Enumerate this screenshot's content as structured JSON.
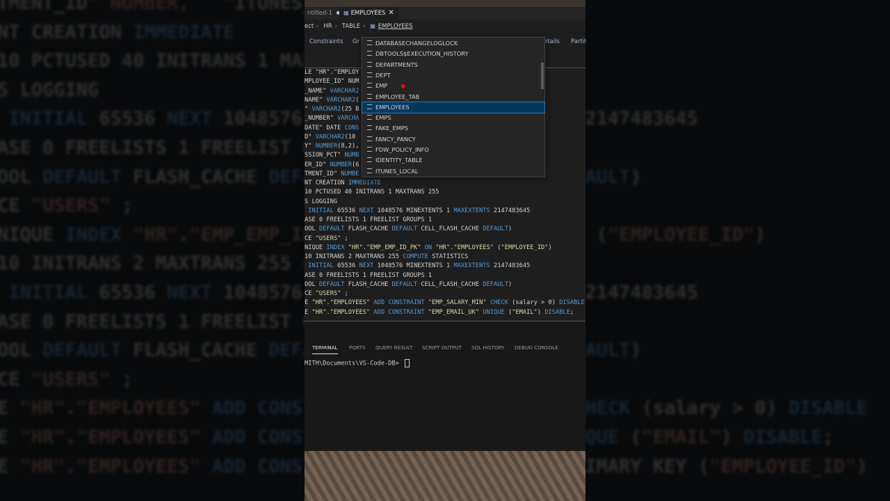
{
  "background": {
    "lines": [
      "TMENT_ID\" NUMBER,   \"ITUNES_LOCAL",
      "NT CREATION IMMEDIATE",
      "10 PCTUSED 40 INITRANS 1 MAXTRANS 255",
      "S LOGGING",
      " INITIAL 65536 NEXT 1048576 MINEXTENTS 1 MAXEXTENTS 2147483645",
      "ASE 0 FREELISTS 1 FREELIST GROUPS 1",
      "OOL DEFAULT FLASH_CACHE DEFAULT CELL_FLASH_CACHE DEFAULT)",
      "CE \"USERS\" ;",
      "NIQUE INDEX \"HR\".\"EMP_EMP_ID_PK\" ON \"HR\".\"EMPLOYEES\" (\"EMPLOYEE_ID\")",
      "10 INITRANS 2 MAXTRANS 255 COMPUTE STATISTICS",
      " INITIAL 65536 NEXT 1048576 MINEXTENTS 1 MAXEXTENTS 2147483645",
      "ASE 0 FREELISTS 1 FREELIST GROUPS 1",
      "OOL DEFAULT FLASH_CACHE DEFAULT CELL_FLASH_CACHE DEFAULT)",
      "CE \"USERS\" ;",
      "E \"HR\".\"EMPLOYEES\" ADD CONSTRAINT \"EMP_SALARY_MIN\" CHECK (salary > 0) DISABLE",
      "E \"HR\".\"EMPLOYEES\" ADD CONSTRAINT \"EMP_EMAIL_UK\" UNIQUE (\"EMAIL\") DISABLE;",
      "E \"HR\".\"EMPLOYEES\" ADD CONSTRAINT \"EMP_EMP_ID_PK\" PRIMARY KEY (\"EMPLOYEE_ID\")"
    ]
  },
  "tabs": {
    "untitled": "ntitled-1",
    "active": "EMPLOYEES"
  },
  "breadcrumb": {
    "items": [
      "ect",
      "HR",
      "TABLE",
      "EMPLOYEES"
    ]
  },
  "subtabs": {
    "constraints": "Constraints",
    "grants": "Gr",
    "details": "etails",
    "partitions": "Partiti"
  },
  "code": {
    "lines": [
      "LE \"HR\".\"EMPLOY",
      "MPLOYEE_ID\" NUM",
      "_NAME\" VARCHAR2",
      "NAME\" VARCHAR2(                                              ABLE,",
      "\" VARCHAR2(25 B",
      "_NUMBER\" VARCHA",
      "DATE\" DATE CONS",
      "D\" VARCHAR2(10",
      "Y\" NUMBER(8,2),",
      "SSION_PCT\" NUMB",
      "ER_ID\" NUMBER(6",
      "TMENT_ID\" NUMBE",
      "NT CREATION IMMEDIATE",
      "10 PCTUSED 40 INITRANS 1 MAXTRANS 255",
      "S LOGGING",
      " INITIAL 65536 NEXT 1048576 MINEXTENTS 1 MAXEXTENTS 2147483645",
      "ASE 0 FREELISTS 1 FREELIST GROUPS 1",
      "OOL DEFAULT FLASH_CACHE DEFAULT CELL_FLASH_CACHE DEFAULT)",
      "CE \"USERS\" ;",
      "NIQUE INDEX \"HR\".\"EMP_EMP_ID_PK\" ON \"HR\".\"EMPLOYEES\" (\"EMPLOYEE_ID\")",
      "10 INITRANS 2 MAXTRANS 255 COMPUTE STATISTICS",
      " INITIAL 65536 NEXT 1048576 MINEXTENTS 1 MAXEXTENTS 2147483645",
      "ASE 0 FREELISTS 1 FREELIST GROUPS 1",
      "OOL DEFAULT FLASH_CACHE DEFAULT CELL_FLASH_CACHE DEFAULT)",
      "CE \"USERS\" ;",
      "E \"HR\".\"EMPLOYEES\" ADD CONSTRAINT \"EMP_SALARY_MIN\" CHECK (salary > 0) DISABLE",
      "E \"HR\".\"EMPLOYEES\" ADD CONSTRAINT \"EMP_EMAIL_UK\" UNIQUE (\"EMAIL\") DISABLE;"
    ]
  },
  "suggestions": {
    "items": [
      "DATABASECHANGELOGLOCK",
      "DBTOOLS$EXECUTION_HISTORY",
      "DEPARTMENTS",
      "DEPT",
      "EMP",
      "EMPLOYEE_TAB",
      "EMPLOYEES",
      "EMPS",
      "FAKE_EMPS",
      "FANCY_PANCY",
      "FDW_POLICY_INFO",
      "IDENTITY_TABLE",
      "ITUNES_LOCAL"
    ],
    "selected_index": 6
  },
  "panel": {
    "tabs": [
      "TERMINAL",
      "PORTS",
      "QUERY RESULT",
      "SCRIPT OUTPUT",
      "SQL HISTORY",
      "DEBUG CONSOLE"
    ],
    "prompt": "MITH\\Documents\\VS-Code-DB> "
  },
  "colors": {
    "keyword": "#569cd6",
    "string": "#dcdcaa",
    "selection": "#04395e",
    "breakpoint": "#e51400"
  }
}
